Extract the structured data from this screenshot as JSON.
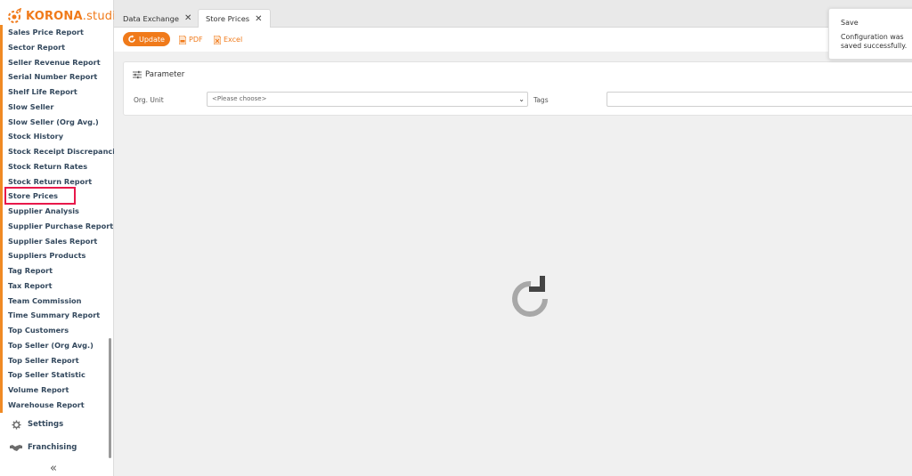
{
  "app": {
    "brand_bold": "KORONA",
    "brand_light": ".studio",
    "brand_color": "#f07a1a"
  },
  "sidebar": {
    "items": [
      {
        "label": "Sales Price Report"
      },
      {
        "label": "Sector Report"
      },
      {
        "label": "Seller Revenue Report"
      },
      {
        "label": "Serial Number Report"
      },
      {
        "label": "Shelf Life Report"
      },
      {
        "label": "Slow Seller"
      },
      {
        "label": "Slow Seller (Org Avg.)"
      },
      {
        "label": "Stock History"
      },
      {
        "label": "Stock Receipt Discrepancies"
      },
      {
        "label": "Stock Return Rates"
      },
      {
        "label": "Stock Return Report"
      },
      {
        "label": "Store Prices"
      },
      {
        "label": "Supplier Analysis"
      },
      {
        "label": "Supplier Purchase Report"
      },
      {
        "label": "Supplier Sales Report"
      },
      {
        "label": "Suppliers Products"
      },
      {
        "label": "Tag Report"
      },
      {
        "label": "Tax Report"
      },
      {
        "label": "Team Commission"
      },
      {
        "label": "Time Summary Report"
      },
      {
        "label": "Top Customers"
      },
      {
        "label": "Top Seller (Org Avg.)"
      },
      {
        "label": "Top Seller Report"
      },
      {
        "label": "Top Seller Statistic"
      },
      {
        "label": "Volume Report"
      },
      {
        "label": "Warehouse Report"
      }
    ],
    "settings_label": "Settings",
    "settings_icon": "gear-icon",
    "franchising_label": "Franchising",
    "franchising_icon": "handshake-icon",
    "collapse_glyph": "«",
    "highlighted_item": "Store Prices",
    "highlight_color": "#e8184a"
  },
  "tabs": [
    {
      "label": "Data Exchange",
      "close": "✕",
      "active": false
    },
    {
      "label": "Store Prices",
      "close": "✕",
      "active": true
    }
  ],
  "toolbar": {
    "update_label": "Update",
    "pdf_label": "PDF",
    "excel_label": "Excel"
  },
  "parameter": {
    "title": "Parameter",
    "org_unit_label": "Org. Unit",
    "org_unit_value": "<Please choose>",
    "tags_label": "Tags",
    "tags_value": ""
  },
  "toast": {
    "title": "Save",
    "message": "Configuration was saved successfully."
  },
  "loading_icon": "reload-spinner-icon"
}
